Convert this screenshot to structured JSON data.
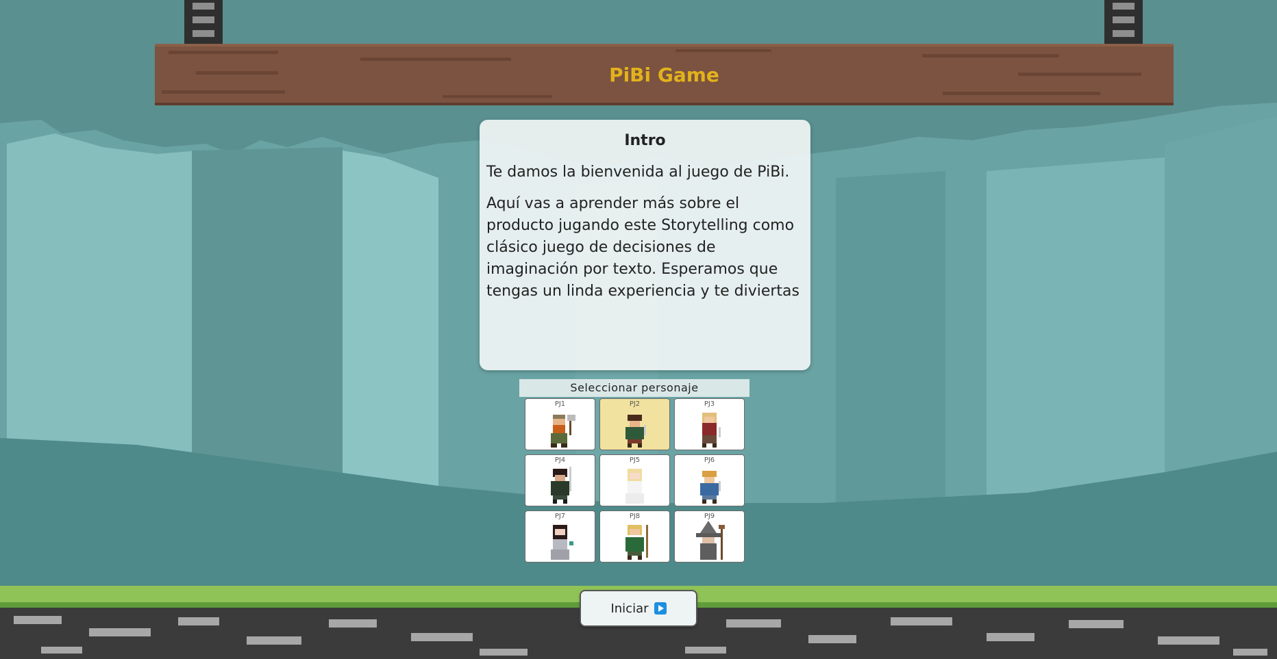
{
  "header": {
    "title": "PiBi Game"
  },
  "intro": {
    "title": "Intro",
    "paragraphs": [
      "Te damos la bienvenida al juego de PiBi.",
      "Aquí vas a aprender más sobre el producto jugando este Storytelling como clásico juego de decisiones de imaginación por texto. Esperamos que tengas un linda experiencia y te diviertas"
    ]
  },
  "character_select": {
    "label": "Seleccionar personaje",
    "selected": "PJ2",
    "characters": [
      {
        "id": "PJ1",
        "icon": "dwarf-axe-icon"
      },
      {
        "id": "PJ2",
        "icon": "hobbit-sword-icon"
      },
      {
        "id": "PJ3",
        "icon": "blonde-warrior-icon"
      },
      {
        "id": "PJ4",
        "icon": "ranger-sword-icon"
      },
      {
        "id": "PJ5",
        "icon": "white-lady-icon"
      },
      {
        "id": "PJ6",
        "icon": "blonde-hobbit-icon"
      },
      {
        "id": "PJ7",
        "icon": "elf-lady-icon"
      },
      {
        "id": "PJ8",
        "icon": "elf-archer-icon"
      },
      {
        "id": "PJ9",
        "icon": "grey-wizard-icon"
      }
    ]
  },
  "start_button": {
    "label": "Iniciar",
    "icon": "play-icon"
  },
  "colors": {
    "title": "#e2b21c",
    "plank": "#7c5340",
    "selected_card": "#f1e29f",
    "play_icon": "#1d8fe0"
  }
}
